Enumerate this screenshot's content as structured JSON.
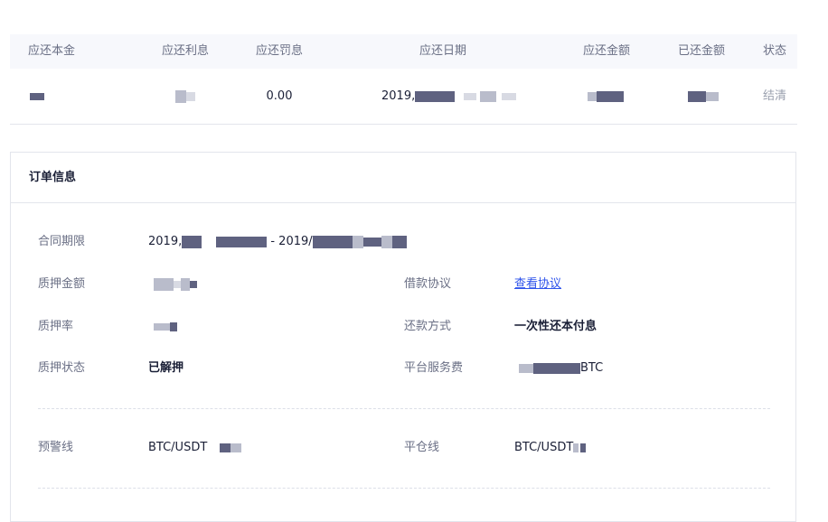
{
  "repayment_table": {
    "headers": {
      "principal": "应还本金",
      "interest": "应还利息",
      "penalty": "应还罚息",
      "due_date": "应还日期",
      "amount_due": "应还金额",
      "amount_paid": "已还金额",
      "status": "状态"
    },
    "row": {
      "penalty": "0.00",
      "due_date_prefix": "2019,",
      "status": "结清"
    }
  },
  "order_info": {
    "title": "订单信息",
    "contract_period": {
      "label": "合同期限",
      "start_prefix": "2019,",
      "separator": "- 2019/"
    },
    "pledge_amount": {
      "label": "质押金额"
    },
    "loan_agreement": {
      "label": "借款协议",
      "link_text": "查看协议"
    },
    "pledge_rate": {
      "label": "质押率"
    },
    "repayment_method": {
      "label": "还款方式",
      "value": "一次性还本付息"
    },
    "pledge_status": {
      "label": "质押状态",
      "value": "已解押"
    },
    "platform_fee": {
      "label": "平台服务费",
      "suffix": "BTC"
    },
    "warning_line": {
      "label": "预警线",
      "value": "BTC/USDT"
    },
    "liquidation_line": {
      "label": "平仓线",
      "value": "BTC/USDT"
    }
  },
  "colors": {
    "link": "#2f54eb",
    "muted": "#6a6f85",
    "header_bg": "#f7f8fc",
    "border": "#e3e5ec"
  }
}
